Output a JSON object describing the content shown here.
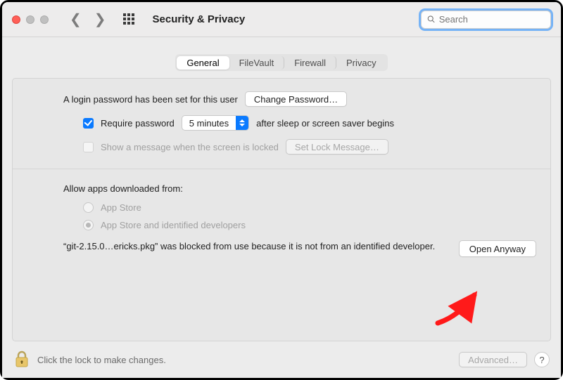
{
  "titlebar": {
    "title": "Security & Privacy",
    "search_placeholder": "Search"
  },
  "tabs": [
    "General",
    "FileVault",
    "Firewall",
    "Privacy"
  ],
  "tabs_active_index": 0,
  "login": {
    "text": "A login password has been set for this user",
    "change_btn": "Change Password…",
    "require_label": "Require password",
    "require_dropdown": "5 minutes",
    "require_suffix": "after sleep or screen saver begins",
    "show_msg_label": "Show a message when the screen is locked",
    "set_lock_btn": "Set Lock Message…"
  },
  "allow": {
    "header": "Allow apps downloaded from:",
    "option1": "App Store",
    "option2": "App Store and identified developers",
    "blocked_msg": "“git-2.15.0…ericks.pkg” was blocked from use because it is not from an identified developer.",
    "open_anyway": "Open Anyway"
  },
  "footer": {
    "lock_text": "Click the lock to make changes.",
    "advanced_btn": "Advanced…",
    "help": "?"
  }
}
